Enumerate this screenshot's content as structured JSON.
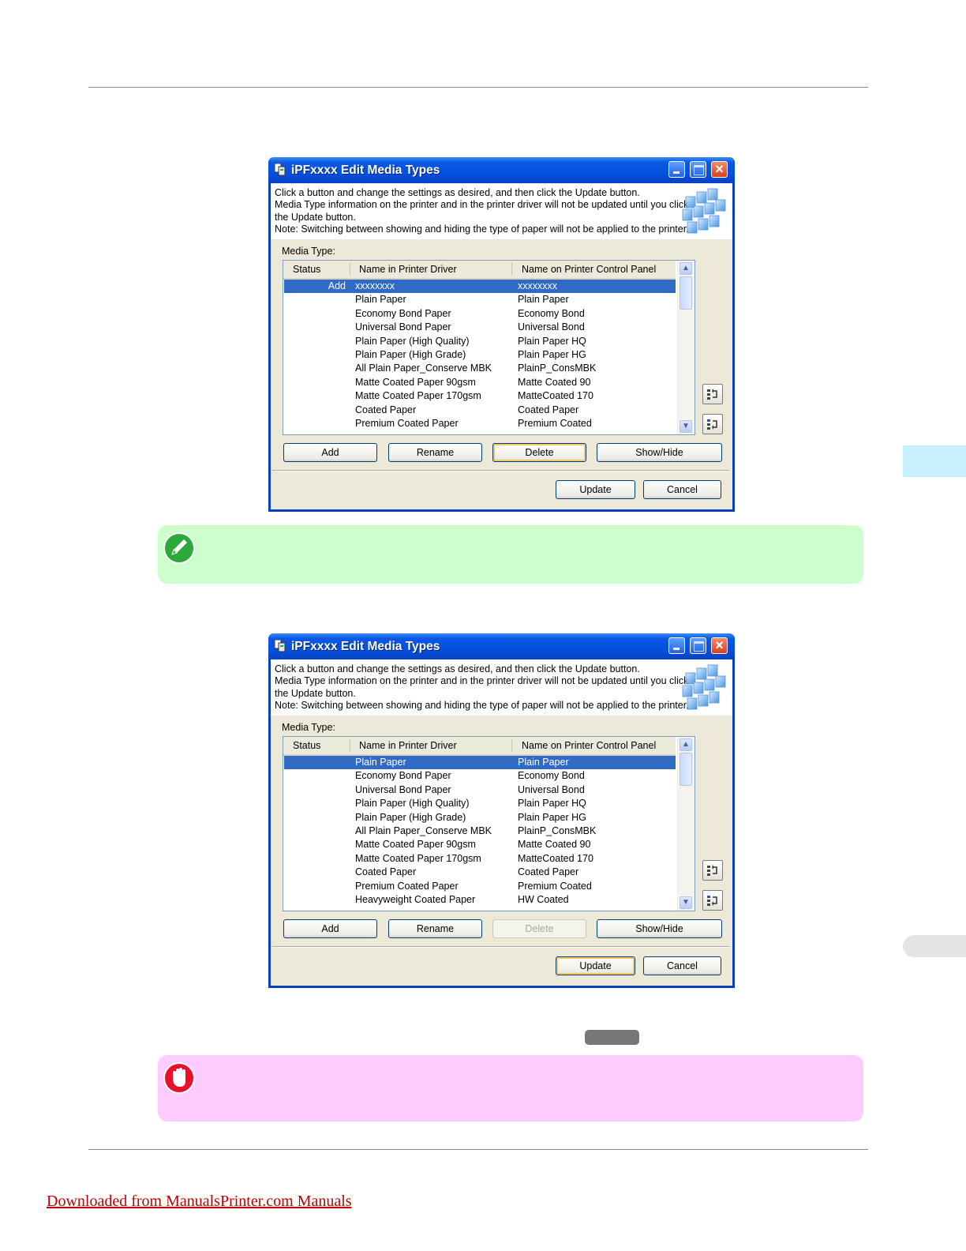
{
  "dialogs": [
    {
      "title": "iPFxxxx Edit Media Types",
      "banner": [
        "Click a button and change the settings as desired, and then click the Update button.",
        "Media Type information on the printer and in the printer driver will not be updated until you click",
        "the Update button.",
        "Note: Switching between showing and hiding the type of paper will not be applied to the printer."
      ],
      "media_type_label": "Media Type:",
      "columns": [
        "Status",
        "Name in Printer Driver",
        "Name on Printer Control Panel"
      ],
      "rows": [
        {
          "status": "Add",
          "driver": "xxxxxxxx",
          "panel": "xxxxxxxx",
          "selected": true
        },
        {
          "status": "",
          "driver": "Plain Paper",
          "panel": "Plain Paper"
        },
        {
          "status": "",
          "driver": "Economy Bond Paper",
          "panel": "Economy Bond"
        },
        {
          "status": "",
          "driver": "Universal Bond Paper",
          "panel": "Universal Bond"
        },
        {
          "status": "",
          "driver": "Plain Paper (High Quality)",
          "panel": "Plain Paper HQ"
        },
        {
          "status": "",
          "driver": "Plain Paper (High Grade)",
          "panel": "Plain Paper HG"
        },
        {
          "status": "",
          "driver": "All Plain Paper_Conserve MBK",
          "panel": "PlainP_ConsMBK"
        },
        {
          "status": "",
          "driver": "Matte Coated Paper 90gsm",
          "panel": "Matte Coated 90"
        },
        {
          "status": "",
          "driver": "Matte Coated Paper 170gsm",
          "panel": "MatteCoated 170"
        },
        {
          "status": "",
          "driver": "Coated Paper",
          "panel": "Coated Paper"
        },
        {
          "status": "",
          "driver": "Premium Coated Paper",
          "panel": "Premium Coated"
        }
      ],
      "buttons": {
        "add": "Add",
        "rename": "Rename",
        "delete": "Delete",
        "show_hide": "Show/Hide"
      },
      "delete_enabled": true,
      "focused": "delete",
      "footer": {
        "update": "Update",
        "cancel": "Cancel"
      }
    },
    {
      "title": "iPFxxxx Edit Media Types",
      "banner": [
        "Click a button and change the settings as desired, and then click the Update button.",
        "Media Type information on the printer and in the printer driver will not be updated until you click",
        "the Update button.",
        "Note: Switching between showing and hiding the type of paper will not be applied to the printer."
      ],
      "media_type_label": "Media Type:",
      "columns": [
        "Status",
        "Name in Printer Driver",
        "Name on Printer Control Panel"
      ],
      "rows": [
        {
          "status": "",
          "driver": "Plain Paper",
          "panel": "Plain Paper",
          "selected": true
        },
        {
          "status": "",
          "driver": "Economy Bond Paper",
          "panel": "Economy Bond"
        },
        {
          "status": "",
          "driver": "Universal Bond Paper",
          "panel": "Universal Bond"
        },
        {
          "status": "",
          "driver": "Plain Paper (High Quality)",
          "panel": "Plain Paper HQ"
        },
        {
          "status": "",
          "driver": "Plain Paper (High Grade)",
          "panel": "Plain Paper HG"
        },
        {
          "status": "",
          "driver": "All Plain Paper_Conserve MBK",
          "panel": "PlainP_ConsMBK"
        },
        {
          "status": "",
          "driver": "Matte Coated Paper 90gsm",
          "panel": "Matte Coated 90"
        },
        {
          "status": "",
          "driver": "Matte Coated Paper 170gsm",
          "panel": "MatteCoated 170"
        },
        {
          "status": "",
          "driver": "Coated Paper",
          "panel": "Coated Paper"
        },
        {
          "status": "",
          "driver": "Premium Coated Paper",
          "panel": "Premium Coated"
        },
        {
          "status": "",
          "driver": "Heavyweight Coated Paper",
          "panel": "HW Coated"
        }
      ],
      "buttons": {
        "add": "Add",
        "rename": "Rename",
        "delete": "Delete",
        "show_hide": "Show/Hide"
      },
      "delete_enabled": false,
      "focused": "update",
      "footer": {
        "update": "Update",
        "cancel": "Cancel"
      }
    }
  ],
  "notes": {
    "note_icon": "pencil-note-icon",
    "important_icon": "stop-hand-icon"
  },
  "colors": {
    "note_bg": "#ccffcc",
    "important_bg": "#ffccff",
    "selection": "#316ac5",
    "titlebar": "#0551e0"
  },
  "footer_link": "Downloaded from ManualsPrinter.com Manuals"
}
